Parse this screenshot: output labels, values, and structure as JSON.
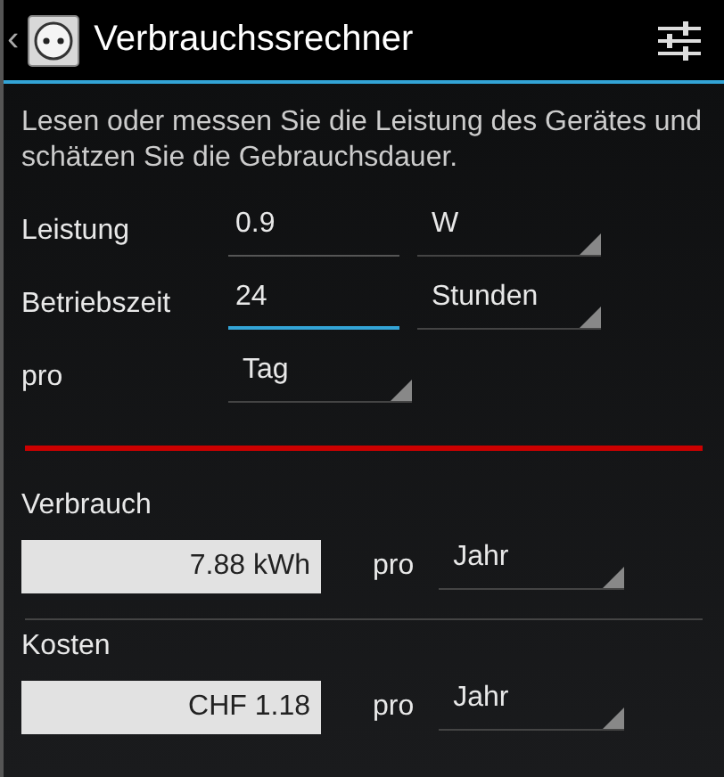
{
  "action_bar": {
    "back": "‹",
    "title": "Verbrauchssrechner"
  },
  "intro": "Lesen oder messen Sie die Leistung des Gerätes und schätzen Sie die Gebrauchsdauer.",
  "inputs": [
    {
      "kind": "number",
      "label": "Leistung",
      "value": "0.9",
      "focused": false,
      "unit": "W"
    },
    {
      "kind": "number",
      "label": "Betriebszeit",
      "value": "24",
      "focused": true,
      "unit": "Stunden"
    },
    {
      "kind": "select",
      "label": "pro",
      "value": "Tag"
    }
  ],
  "results": [
    {
      "label": "Verbrauch",
      "value": "7.88 kWh",
      "per": "pro",
      "period": "Jahr"
    },
    {
      "label": "Kosten",
      "value": "CHF 1.18",
      "per": "pro",
      "period": "Jahr"
    }
  ]
}
